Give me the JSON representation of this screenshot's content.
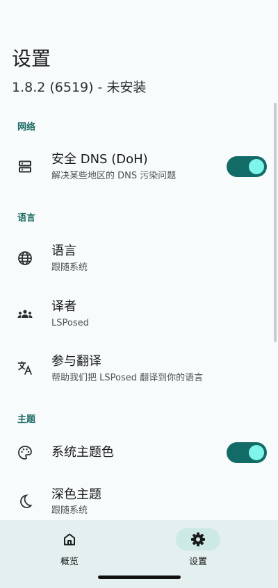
{
  "header": {
    "title": "设置",
    "subtitle": "1.8.2 (6519) - 未安装"
  },
  "sections": {
    "network": {
      "label": "网络",
      "dns": {
        "title": "安全 DNS (DoH)",
        "summary": "解决某些地区的 DNS 污染问题",
        "icon": "dns-icon",
        "enabled": true
      }
    },
    "language": {
      "label": "语言",
      "language": {
        "title": "语言",
        "summary": "跟随系统",
        "icon": "globe-icon"
      },
      "translators": {
        "title": "译者",
        "summary": "LSPosed",
        "icon": "people-group-icon"
      },
      "translate": {
        "title": "参与翻译",
        "summary": "帮助我们把 LSPosed 翻译到你的语言",
        "icon": "translate-icon"
      }
    },
    "theme": {
      "label": "主题",
      "system_color": {
        "title": "系统主题色",
        "icon": "palette-icon",
        "enabled": true
      },
      "dark_theme": {
        "title": "深色主题",
        "summary": "跟随系统",
        "icon": "moon-icon"
      }
    }
  },
  "bottom_nav": {
    "items": [
      {
        "label": "概览",
        "icon": "home-icon",
        "active": false
      },
      {
        "label": "设置",
        "icon": "gear-icon",
        "active": true
      }
    ]
  },
  "colors": {
    "accent": "#136b67",
    "switch_thumb": "#7ff4ea",
    "background": "#f7fbfb",
    "nav_background": "#e3f0ef"
  }
}
